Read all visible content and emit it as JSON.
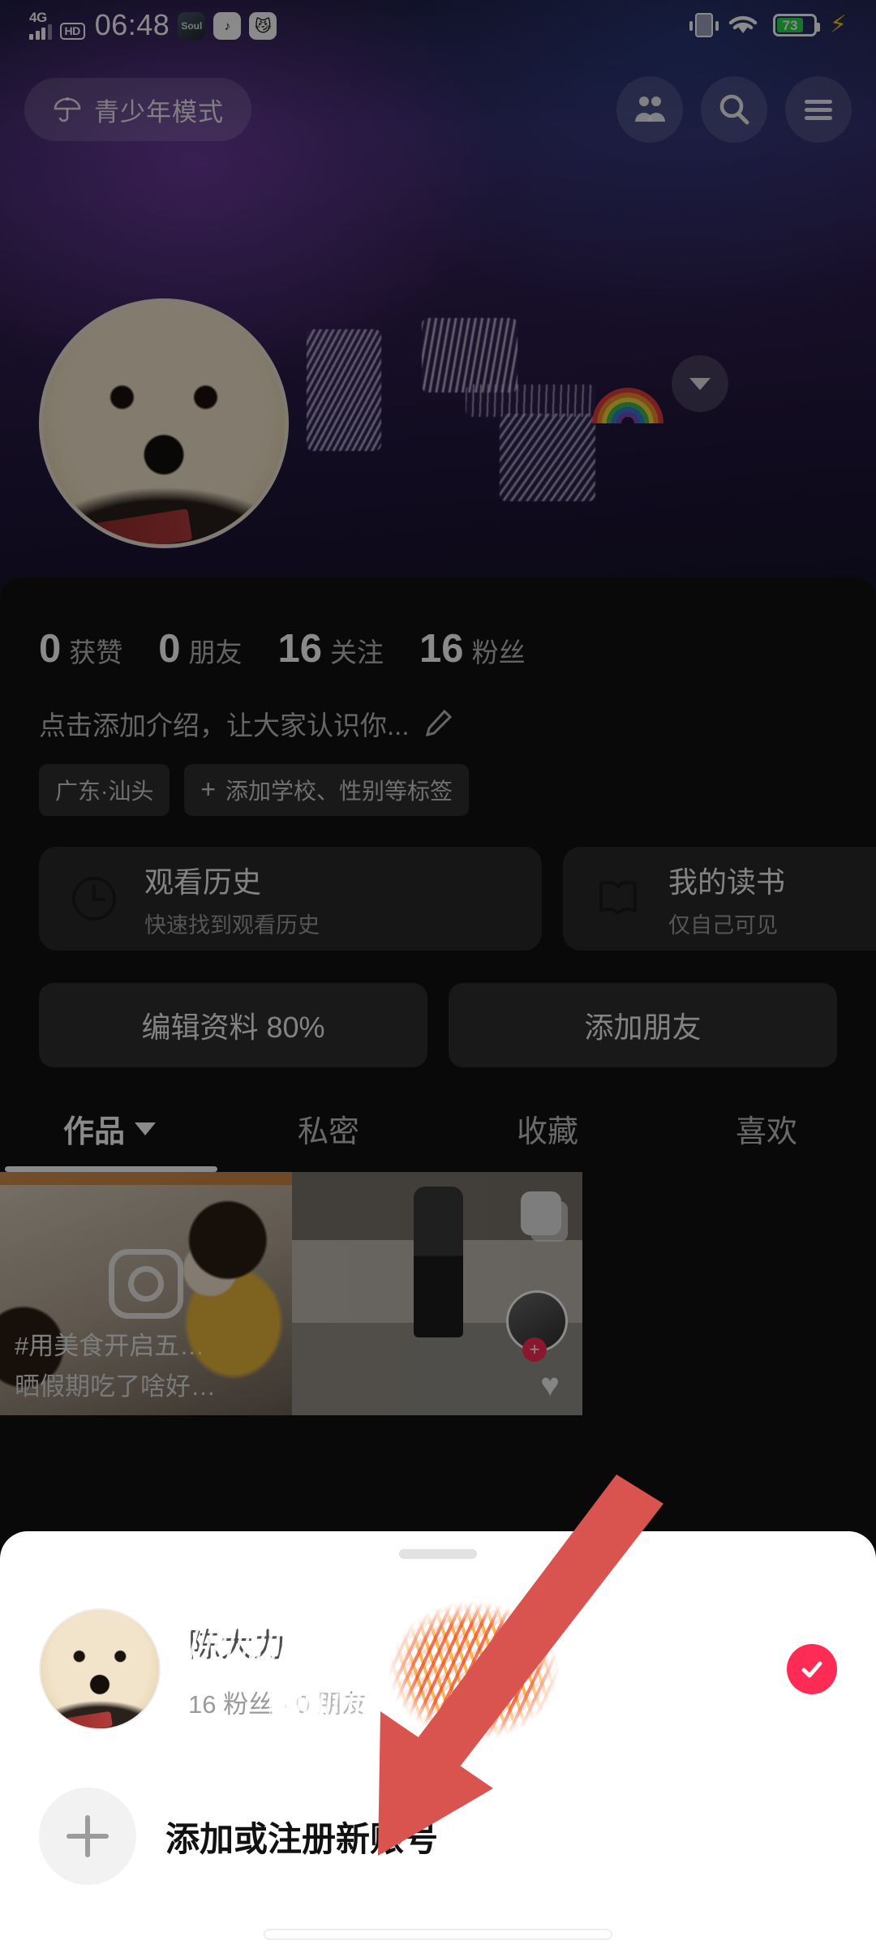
{
  "status_bar": {
    "network_type": "4G",
    "hd_label": "HD",
    "time": "06:48",
    "app_icons": [
      {
        "name": "soul-app-icon",
        "glyph": "Soul"
      },
      {
        "name": "douyin-app-icon",
        "glyph": "♪"
      },
      {
        "name": "cat-app-icon",
        "glyph": "😼"
      }
    ],
    "vibrate_icon": "vibrate-icon",
    "wifi_icon": "wifi-icon",
    "battery_percent": "73",
    "battery_color": "#27d94a",
    "charging_icon": "charging-bolt-icon"
  },
  "top_nav": {
    "teen_mode_label": "青少年模式",
    "teen_mode_icon": "umbrella-icon",
    "friends_icon": "friends-icon",
    "search_icon": "search-icon",
    "menu_icon": "hamburger-menu-icon",
    "expand_icon": "chevron-down-icon"
  },
  "profile": {
    "avatar_name": "profile-avatar",
    "stats": [
      {
        "num": "0",
        "label": "获赞"
      },
      {
        "num": "0",
        "label": "朋友"
      },
      {
        "num": "16",
        "label": "关注"
      },
      {
        "num": "16",
        "label": "粉丝"
      }
    ],
    "bio_placeholder": "点击添加介绍，让大家认识你...",
    "bio_edit_icon": "pencil-edit-icon",
    "tags": [
      {
        "name": "location-tag",
        "label": "广东·汕头",
        "has_plus": false
      },
      {
        "name": "add-tag",
        "label": "添加学校、性别等标签",
        "has_plus": true
      }
    ],
    "cards": [
      {
        "name": "watch-history-card",
        "icon": "clock-icon",
        "title": "观看历史",
        "subtitle": "快速找到观看历史"
      },
      {
        "name": "my-reading-card",
        "icon": "book-icon",
        "title": "我的读书",
        "subtitle": "仅自己可见"
      },
      {
        "name": "my-music-card",
        "icon": "music-note-icon",
        "title": "",
        "subtitle": ""
      }
    ],
    "actions": [
      {
        "name": "edit-profile-button",
        "label": "编辑资料 80%"
      },
      {
        "name": "add-friend-button",
        "label": "添加朋友"
      }
    ],
    "tabs": [
      {
        "name": "tab-works",
        "label": "作品",
        "active": true,
        "has_caret": true
      },
      {
        "name": "tab-private",
        "label": "私密",
        "active": false,
        "has_caret": false
      },
      {
        "name": "tab-favorites",
        "label": "收藏",
        "active": false,
        "has_caret": false
      },
      {
        "name": "tab-likes",
        "label": "喜欢",
        "active": false,
        "has_caret": false
      }
    ],
    "grid": [
      {
        "name": "video-cell-1",
        "caption_line1": "#用美食开启五…",
        "caption_line2": "晒假期吃了啥好…",
        "camera_icon": "camera-icon"
      },
      {
        "name": "video-cell-2",
        "caption_line1": "",
        "caption_line2": "",
        "camera_icon": ""
      }
    ]
  },
  "account_sheet": {
    "drag_handle": "sheet-drag-handle",
    "accounts": [
      {
        "name": "account-row",
        "display_name": "陈大力",
        "sub": "16 粉丝 · 0 朋友",
        "selected": true,
        "check_color": "#fe2c55"
      }
    ],
    "add_account": {
      "name": "add-account-row",
      "label": "添加或注册新账号",
      "icon": "plus-icon"
    }
  },
  "annotation": {
    "arrow_name": "red-guide-arrow",
    "color": "#d9534f"
  }
}
